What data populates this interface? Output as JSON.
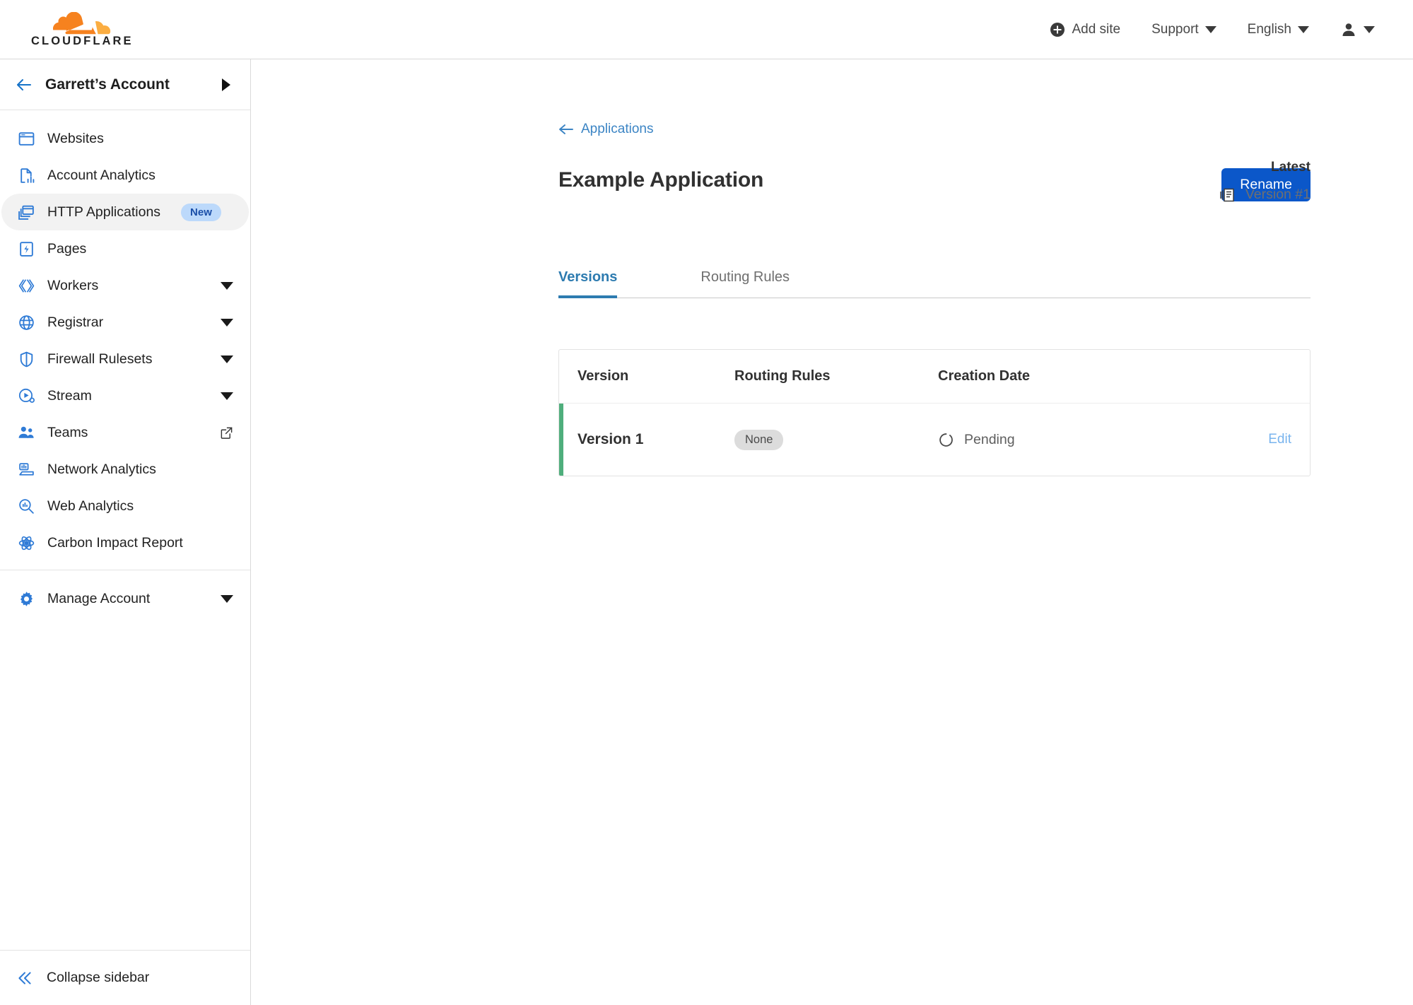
{
  "brand": {
    "name": "CLOUDFLARE",
    "logo_icon": "cloudflare-cloud-logo",
    "colors": {
      "orange_dark": "#f6821f",
      "orange_light": "#fbad41",
      "wordmark": "#222222"
    }
  },
  "topnav": {
    "add_site": {
      "label": "Add site",
      "icon": "plus-circle-icon"
    },
    "support": {
      "label": "Support",
      "icon": "chevron-down-icon"
    },
    "language": {
      "label": "English",
      "icon": "chevron-down-icon"
    },
    "account_menu": {
      "icon": "person-icon",
      "caret": "chevron-down-icon"
    }
  },
  "sidebar": {
    "account": {
      "label": "Garrett’s Account",
      "back_icon": "arrow-left-icon",
      "expand_icon": "triangle-right-icon"
    },
    "items": [
      {
        "label": "Websites",
        "icon": "browser-window-icon",
        "badge": null,
        "trailing": null,
        "active": false
      },
      {
        "label": "Account Analytics",
        "icon": "document-chart-icon",
        "badge": null,
        "trailing": null,
        "active": false
      },
      {
        "label": "HTTP Applications",
        "icon": "stacked-windows-icon",
        "badge": "New",
        "trailing": null,
        "active": true
      },
      {
        "label": "Pages",
        "icon": "pages-bolt-icon",
        "badge": null,
        "trailing": null,
        "active": false
      },
      {
        "label": "Workers",
        "icon": "workers-icon",
        "badge": null,
        "trailing": "caret",
        "active": false
      },
      {
        "label": "Registrar",
        "icon": "globe-icon",
        "badge": null,
        "trailing": "caret",
        "active": false
      },
      {
        "label": "Firewall Rulesets",
        "icon": "shield-icon",
        "badge": null,
        "trailing": "caret",
        "active": false
      },
      {
        "label": "Stream",
        "icon": "stream-play-icon",
        "badge": null,
        "trailing": "caret",
        "active": false
      },
      {
        "label": "Teams",
        "icon": "users-icon",
        "badge": null,
        "trailing": "external-link",
        "active": false
      },
      {
        "label": "Network Analytics",
        "icon": "network-analytics-icon",
        "badge": null,
        "trailing": null,
        "active": false
      },
      {
        "label": "Web Analytics",
        "icon": "magnifier-chart-icon",
        "badge": null,
        "trailing": null,
        "active": false
      },
      {
        "label": "Carbon Impact Report",
        "icon": "atom-icon",
        "badge": null,
        "trailing": null,
        "active": false
      }
    ],
    "manage_account": {
      "label": "Manage Account",
      "icon": "gear-icon",
      "trailing": "caret"
    },
    "collapse": {
      "label": "Collapse sidebar",
      "icon": "chevron-double-left-icon"
    }
  },
  "main": {
    "breadcrumb": {
      "label": "Applications",
      "icon": "arrow-left-icon"
    },
    "page_title": "Example Application",
    "rename_button": "Rename",
    "latest": {
      "label": "Latest",
      "version": "Version #1",
      "icon": "versions-stack-icon"
    },
    "tabs": [
      {
        "label": "Versions",
        "active": true
      },
      {
        "label": "Routing Rules",
        "active": false
      }
    ],
    "table": {
      "columns": [
        "Version",
        "Routing Rules",
        "Creation Date",
        ""
      ],
      "rows": [
        {
          "version": "Version 1",
          "routing_rules": "None",
          "creation_date": "Pending",
          "status_icon": "spinner-icon",
          "action": "Edit",
          "accent_color": "#4fae7c"
        }
      ]
    }
  },
  "colors": {
    "primary_button": "#0b57c9",
    "link": "#3b84c4",
    "tab_active": "#2d7bb0",
    "edit_link": "#79b4ee",
    "badge_bg": "#bcd9fb",
    "badge_text": "#1b4fa8",
    "row_accent": "#4fae7c",
    "pill_bg": "#dcdcdc"
  }
}
